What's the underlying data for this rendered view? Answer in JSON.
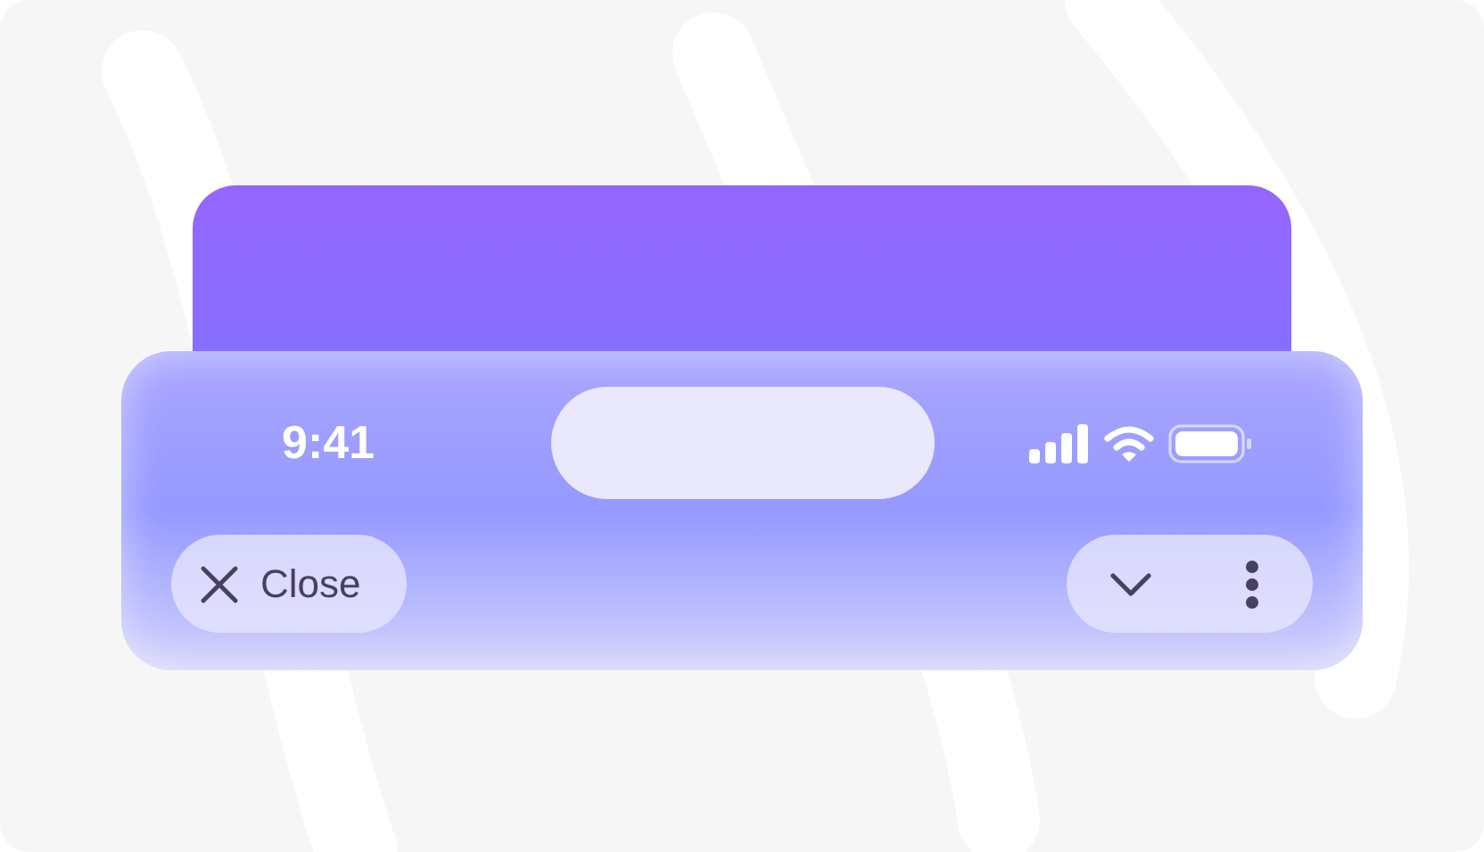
{
  "status_bar": {
    "time": "9:41"
  },
  "toolbar": {
    "close_label": "Close"
  }
}
